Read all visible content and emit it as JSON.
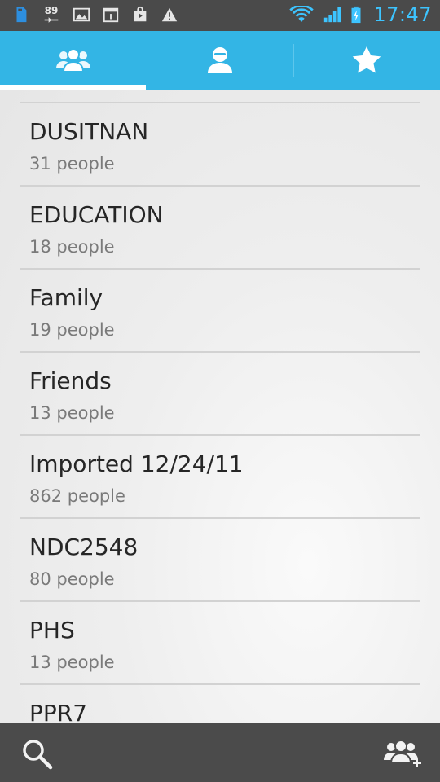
{
  "status_bar": {
    "notification_number": "89",
    "time": "17:47",
    "icons": [
      "sd-card-icon",
      "usb-download-icon",
      "gallery-icon",
      "calendar-icon",
      "play-store-icon",
      "warning-icon",
      "wifi-icon",
      "signal-icon",
      "battery-charging-icon"
    ]
  },
  "tabs": [
    {
      "name": "groups",
      "icon": "groups-icon",
      "selected": true
    },
    {
      "name": "contacts",
      "icon": "person-icon",
      "selected": false
    },
    {
      "name": "favorites",
      "icon": "star-icon",
      "selected": false
    }
  ],
  "groups": [
    {
      "name": "",
      "count": "",
      "partial": true
    },
    {
      "name": "DUSITNAN",
      "count": "31 people"
    },
    {
      "name": "EDUCATION",
      "count": "18 people"
    },
    {
      "name": "Family",
      "count": "19 people"
    },
    {
      "name": "Friends",
      "count": "13 people"
    },
    {
      "name": "Imported 12/24/11",
      "count": "862 people"
    },
    {
      "name": "NDC2548",
      "count": "80 people"
    },
    {
      "name": "PHS",
      "count": "13 people"
    },
    {
      "name": "PPR7",
      "count": ""
    }
  ],
  "bottom_bar": {
    "search_icon": "search-icon",
    "add_group_icon": "add-group-icon"
  },
  "colors": {
    "accent": "#33b5e5",
    "status_bar": "#4a4a4a",
    "time": "#3dc4ff",
    "bottom_bar": "#4b4b4b"
  }
}
